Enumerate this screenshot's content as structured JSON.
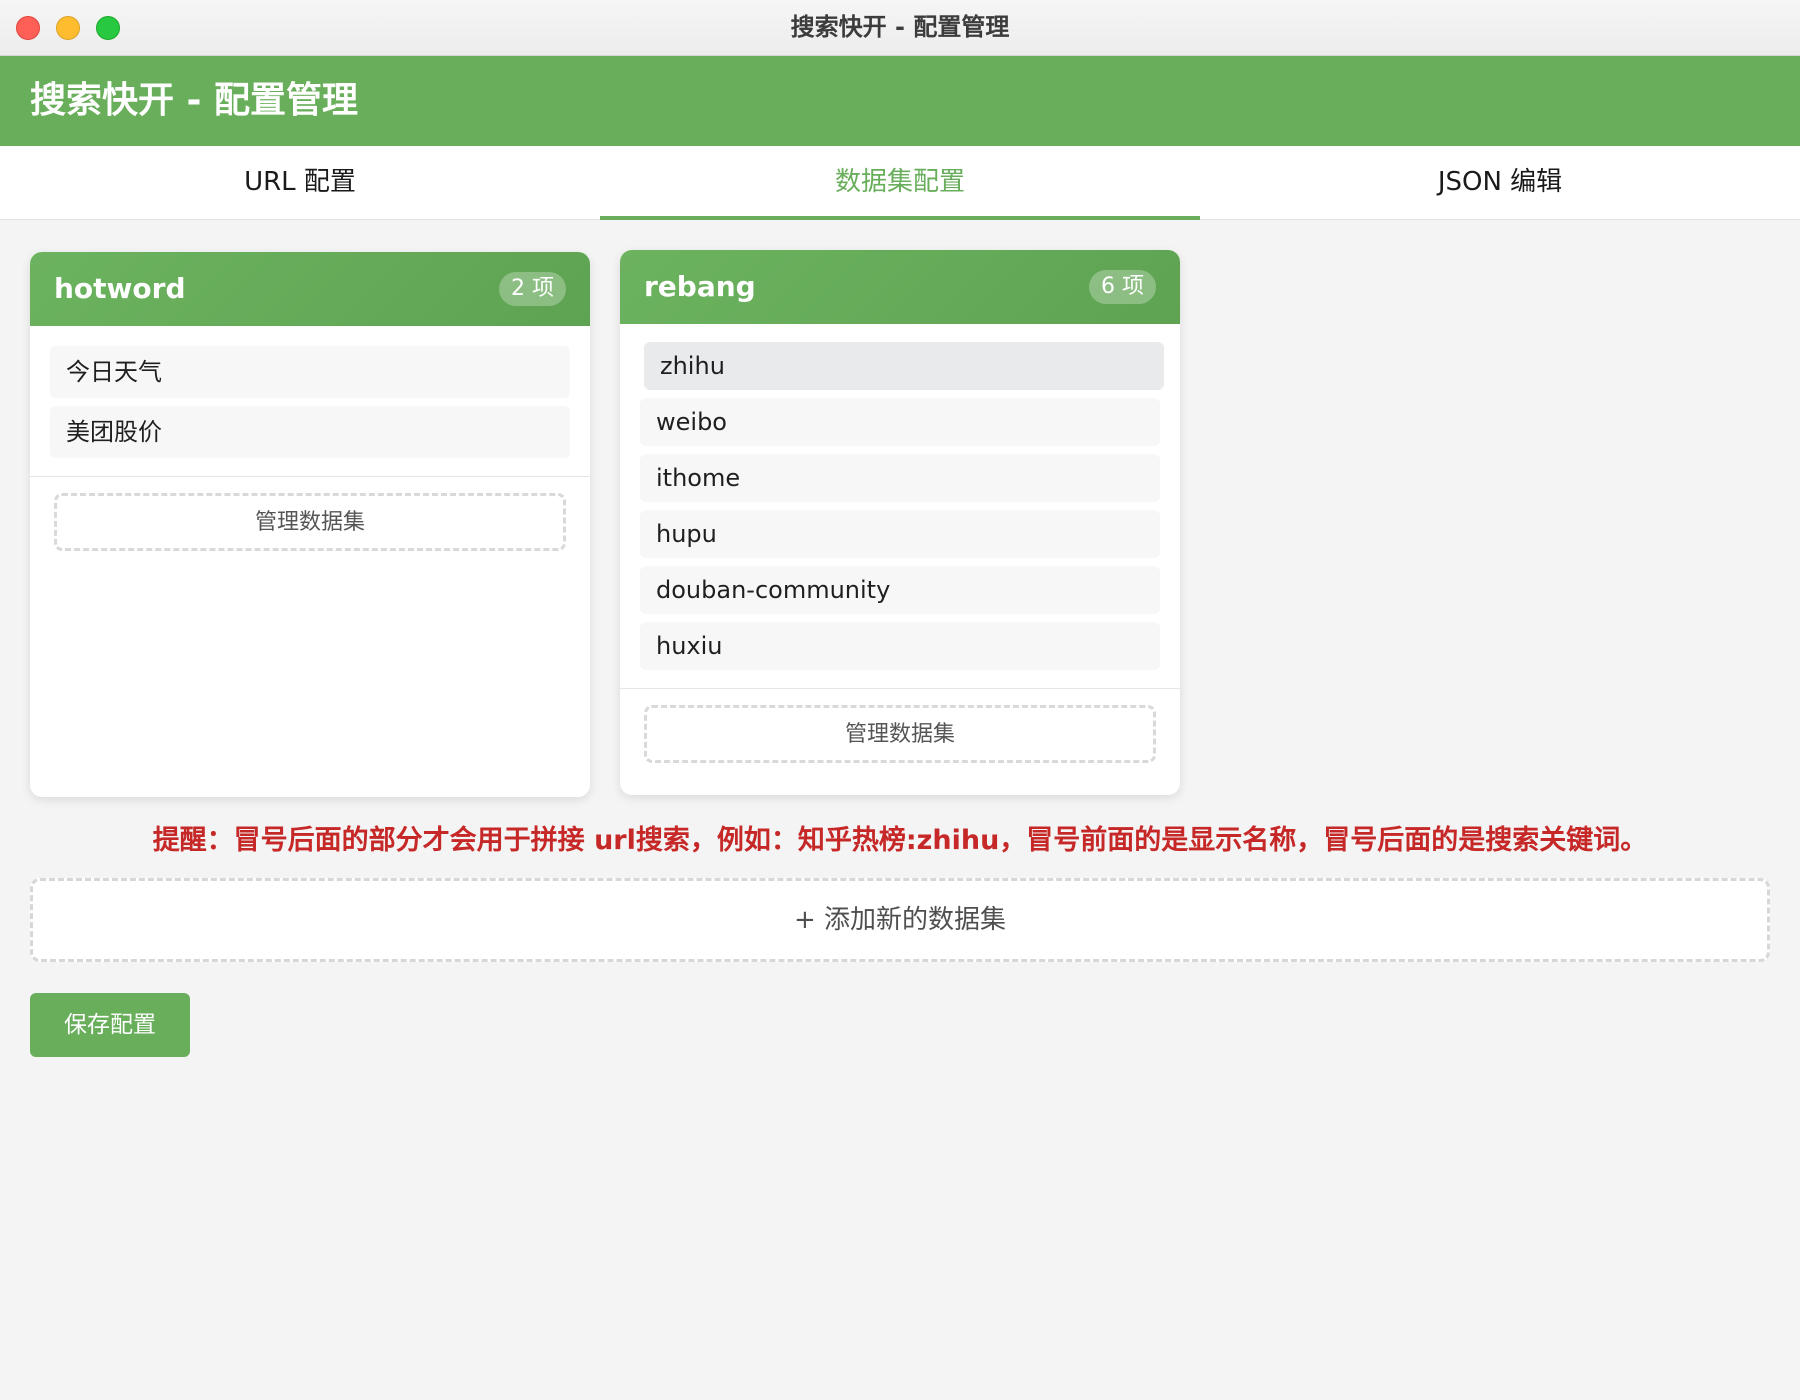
{
  "window": {
    "title": "搜索快开 - 配置管理"
  },
  "header": {
    "title": "搜索快开 - 配置管理"
  },
  "tabs": [
    {
      "label": "URL 配置",
      "active": false
    },
    {
      "label": "数据集配置",
      "active": true
    },
    {
      "label": "JSON 编辑",
      "active": false
    }
  ],
  "datasets": [
    {
      "name": "hotword",
      "count": "2 项",
      "items": [
        "今日天气",
        "美团股价"
      ],
      "manage_label": "管理数据集"
    },
    {
      "name": "rebang",
      "count": "6 项",
      "items": [
        "zhihu",
        "weibo",
        "ithome",
        "hupu",
        "douban-community",
        "huxiu"
      ],
      "manage_label": "管理数据集"
    }
  ],
  "hint": "提醒：冒号后面的部分才会用于拼接 url搜索，例如：知乎热榜:zhihu，冒号前面的是显示名称，冒号后面的是搜索关键词。",
  "add_dataset_label": "+ 添加新的数据集",
  "save_label": "保存配置",
  "colors": {
    "accent": "#68ae5b",
    "hint": "#c62828"
  }
}
